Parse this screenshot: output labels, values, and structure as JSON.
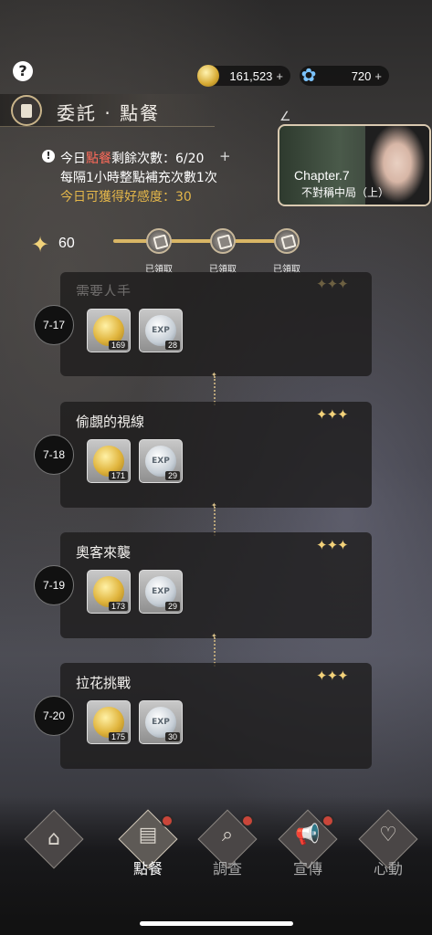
{
  "top_bar": {
    "gold_amount": "161,523",
    "gem_amount": "720",
    "plus": "+",
    "help_glyph": "?"
  },
  "title": "委託 · 點餐",
  "chapter": {
    "number": "Chapter.7",
    "name": "不對稱中局（上）"
  },
  "info": {
    "line1_prefix": "今日",
    "line1_highlight": "點餐",
    "line1_suffix": "剩餘次數：6/20",
    "line2": "每隔1小時整點補充次數1次",
    "line3": "今日可獲得好感度：30",
    "excl": "!"
  },
  "progress": {
    "affinity": "60",
    "nodes": [
      {
        "label": "已領取"
      },
      {
        "label": "已領取"
      },
      {
        "label": "已領取"
      }
    ],
    "fill_fraction": 1.0
  },
  "stages": [
    {
      "id": "7-17",
      "title": "需要人手",
      "stars": "✦✦✦",
      "coin_qty": "169",
      "exp_qty": "28"
    },
    {
      "id": "7-18",
      "title": "偷覷的視線",
      "stars": "✦✦✦",
      "coin_qty": "171",
      "exp_qty": "29"
    },
    {
      "id": "7-19",
      "title": "奧客來襲",
      "stars": "✦✦✦",
      "coin_qty": "173",
      "exp_qty": "29"
    },
    {
      "id": "7-20",
      "title": "拉花挑戰",
      "stars": "✦✦✦",
      "coin_qty": "175",
      "exp_qty": "30"
    }
  ],
  "item_exp_label": "EXP",
  "nav": [
    {
      "label": "",
      "icon": "home-icon",
      "glyph": "⌂"
    },
    {
      "label": "點餐",
      "icon": "order-icon",
      "glyph": "▤"
    },
    {
      "label": "調查",
      "icon": "search-icon",
      "glyph": "⌕"
    },
    {
      "label": "宣傳",
      "icon": "megaphone-icon",
      "glyph": "📢"
    },
    {
      "label": "心動",
      "icon": "heart-icon",
      "glyph": "♡"
    }
  ],
  "colors": {
    "accent_gold": "#e3b64a",
    "highlight_red": "#ff6b5a",
    "notification_red": "#c9463a"
  }
}
